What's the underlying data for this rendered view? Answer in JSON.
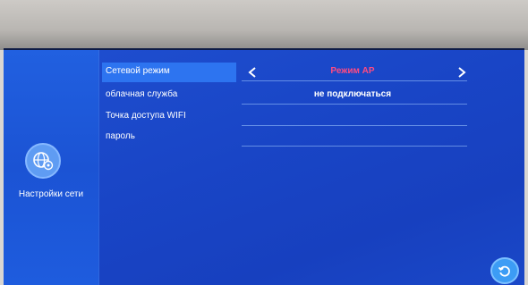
{
  "sidebar": {
    "label": "Настройки сети",
    "icon": "network-settings-icon"
  },
  "settings": {
    "rows": [
      {
        "label": "Сетевой режим",
        "value": "Режим AP",
        "value_color": "#ff4b82",
        "selected": true
      },
      {
        "label": "облачная служба",
        "value": "не подключаться"
      },
      {
        "label": "Точка доступа WIFI",
        "value": ""
      },
      {
        "label": "пароль",
        "value": ""
      }
    ]
  },
  "colors": {
    "screen_bg": "#1945c6",
    "selected_bg": "#2d74f0",
    "accent_value": "#ff4b82"
  },
  "controls": {
    "prev_icon": "chevron-left-icon",
    "next_icon": "chevron-right-icon",
    "back_icon": "refresh-back-icon"
  }
}
